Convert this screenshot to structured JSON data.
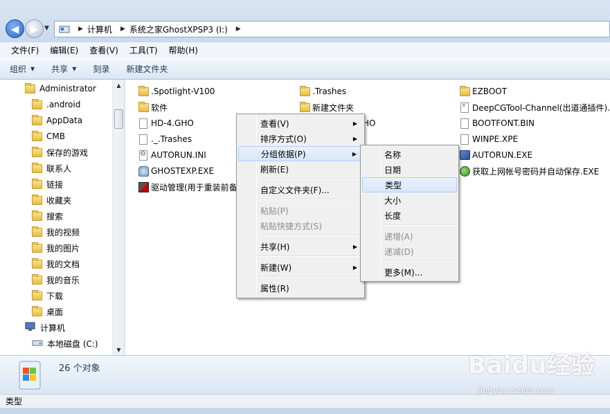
{
  "address": {
    "crumbs": [
      "计算机",
      "系统之家GhostXPSP3 (I:)"
    ]
  },
  "menubar": [
    "文件(F)",
    "编辑(E)",
    "查看(V)",
    "工具(T)",
    "帮助(H)"
  ],
  "toolbar": {
    "organize": "组织",
    "share": "共享",
    "burn": "刻录",
    "new_folder": "新建文件夹"
  },
  "navpane": {
    "items": [
      "Administrator",
      ".android",
      "AppData",
      "CMB",
      "保存的游戏",
      "联系人",
      "链接",
      "收藏夹",
      "搜索",
      "我的视频",
      "我的图片",
      "我的文档",
      "我的音乐",
      "下载",
      "桌面",
      "计算机",
      "本地磁盘 (C:)"
    ]
  },
  "files": {
    "col1": [
      ".Spotlight-V100",
      "软件",
      "HD-4.GHO",
      "._.Trashes",
      "AUTORUN.INI",
      "GHOSTEXP.EXE",
      "驱动管理(用于重装前备"
    ],
    "col2": [
      ".Trashes",
      "新建文件夹",
      "HO"
    ],
    "col3": [
      "EZBOOT",
      "DeepCGTool-Channel(出道通插件)...",
      "BOOTFONT.BIN",
      "WINPE.XPE",
      "AUTORUN.EXE",
      "获取上网帐号密码并自动保存.EXE"
    ]
  },
  "context_menu": {
    "items": [
      "查看(V)",
      "排序方式(O)",
      "分组依据(P)",
      "刷新(E)",
      "自定义文件夹(F)...",
      "粘贴(P)",
      "粘贴快捷方式(S)",
      "共享(H)",
      "新建(W)",
      "属性(R)"
    ]
  },
  "submenu": {
    "items": [
      "名称",
      "日期",
      "类型",
      "大小",
      "长度",
      "递增(A)",
      "递减(D)",
      "更多(M)..."
    ]
  },
  "details": {
    "count": "26 个对象"
  },
  "status": {
    "text": "类型"
  },
  "watermark": {
    "brand": "Baidu经验",
    "url": "jingyan.baidu.com"
  }
}
